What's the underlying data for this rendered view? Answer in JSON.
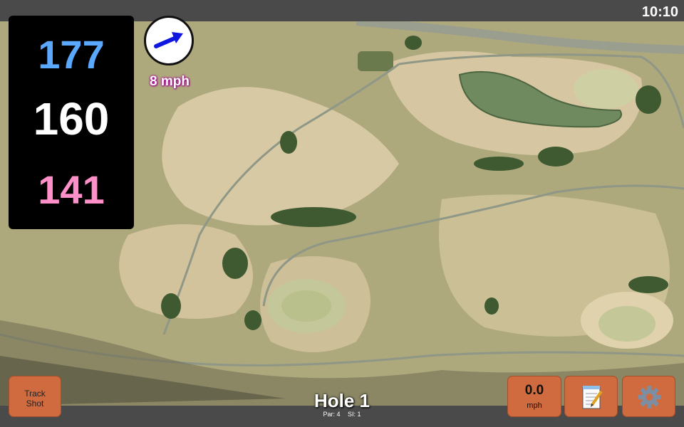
{
  "status": {
    "time": "10:10"
  },
  "distances": {
    "back": "177",
    "middle": "160",
    "front": "141"
  },
  "wind": {
    "speed_label": "8 mph",
    "direction": "northeast",
    "icon": "wind-arrow-icon"
  },
  "buttons": {
    "track_shot": [
      "Track",
      "Shot"
    ],
    "wind_value": "0.0",
    "wind_unit": "mph",
    "notes_icon": "notepad-icon",
    "settings_icon": "gear-icon"
  },
  "hole": {
    "title": "Hole 1",
    "par": "Par: 4",
    "si": "SI: 1"
  },
  "colors": {
    "back": "#5aa8ff",
    "middle": "#ffffff",
    "front": "#ff8fc8",
    "button": "#cf6b3f"
  }
}
